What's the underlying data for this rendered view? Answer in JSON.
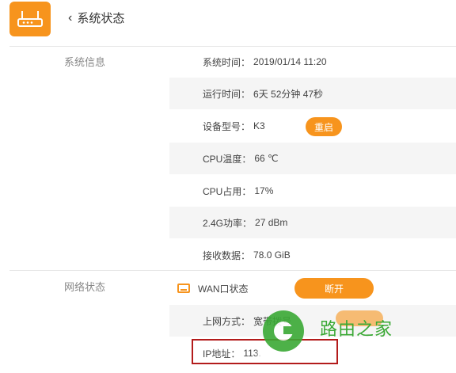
{
  "header": {
    "back_label": "系统状态",
    "logo_icon": "router-icon",
    "accent": "#f7941d"
  },
  "sections": {
    "system_info_label": "系统信息",
    "network_status_label": "网络状态"
  },
  "system_info": [
    {
      "label": "系统时间：",
      "value": "2019/01/14 11:20"
    },
    {
      "label": "运行时间：",
      "value": "6天 52分钟 47秒"
    },
    {
      "label": "设备型号：",
      "value": "K3"
    },
    {
      "label": "CPU温度：",
      "value": "66 ℃"
    },
    {
      "label": "CPU占用：",
      "value": "17%"
    },
    {
      "label": "2.4G功率：",
      "value": "27 dBm"
    },
    {
      "label": "接收数据：",
      "value": "78.0 GiB"
    }
  ],
  "reboot_button": "重启",
  "network": {
    "wan_label": "WAN口状态",
    "disconnect_button": "断开",
    "access_label": "上网方式：",
    "access_value": "宽带拨号",
    "ip_label": "IP地址：",
    "ip_value": "113."
  },
  "watermark": {
    "text": "路由之家"
  }
}
